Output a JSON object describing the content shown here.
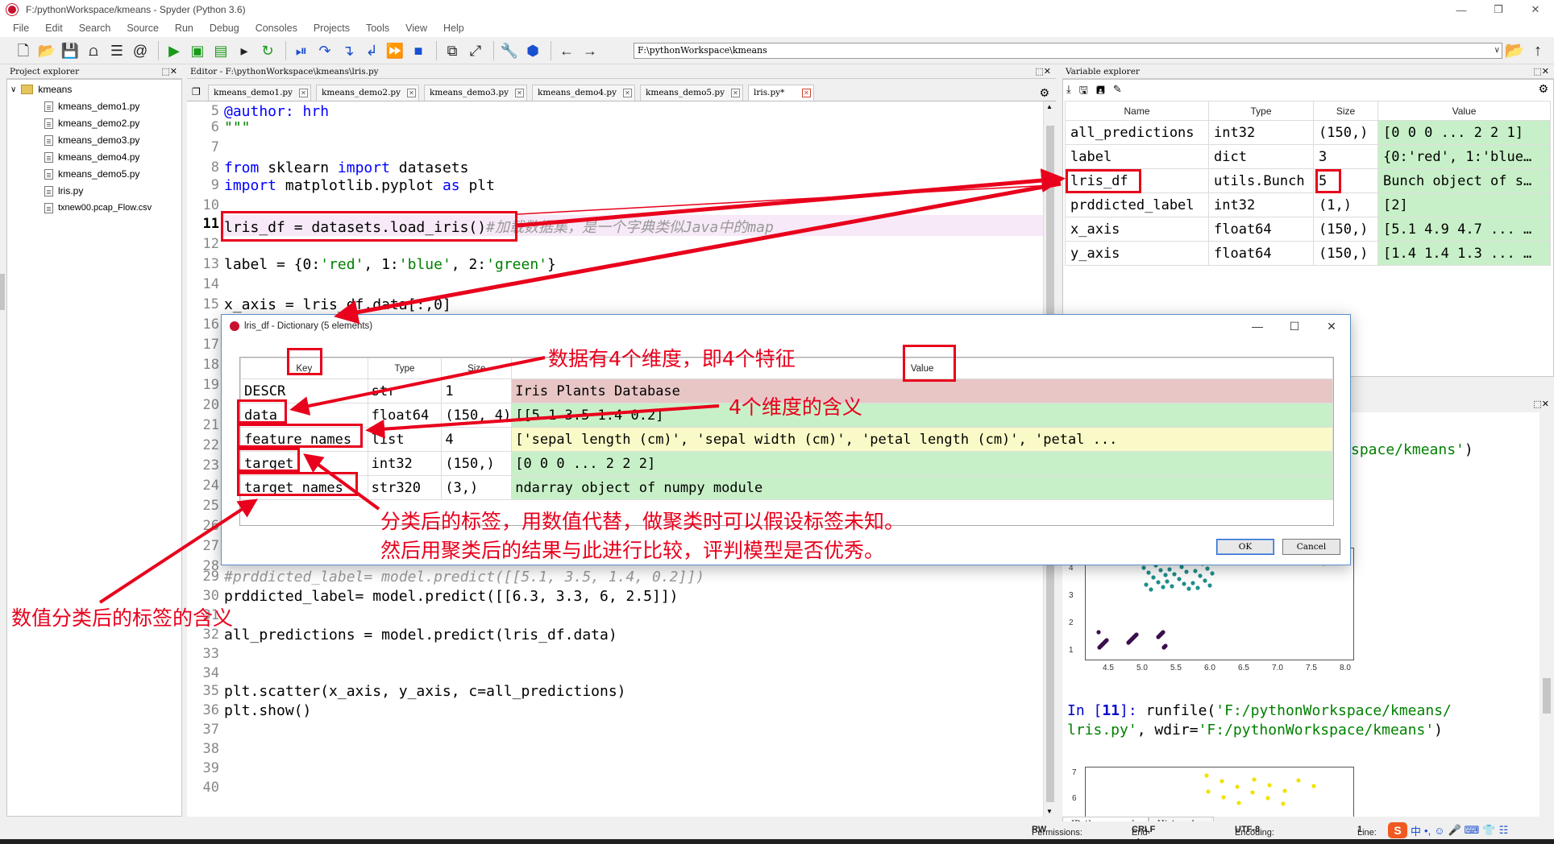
{
  "window": {
    "title": "F:/pythonWorkspace/kmeans - Spyder (Python 3.6)",
    "controls": [
      "—",
      "❒",
      "✕"
    ]
  },
  "menu": [
    "File",
    "Edit",
    "Search",
    "Source",
    "Run",
    "Debug",
    "Consoles",
    "Projects",
    "Tools",
    "View",
    "Help"
  ],
  "toolbar": {
    "path": "F:\\pythonWorkspace\\kmeans"
  },
  "project_explorer": {
    "header": "Project explorer",
    "root": "kmeans",
    "files": [
      "kmeans_demo1.py",
      "kmeans_demo2.py",
      "kmeans_demo3.py",
      "kmeans_demo4.py",
      "kmeans_demo5.py",
      "lris.py",
      "txnew00.pcap_Flow.csv"
    ]
  },
  "editor": {
    "header": "Editor - F:\\pythonWorkspace\\kmeans\\lris.py",
    "tabs": [
      "kmeans_demo1.py",
      "kmeans_demo2.py",
      "kmeans_demo3.py",
      "kmeans_demo4.py",
      "kmeans_demo5.py",
      "lris.py*"
    ],
    "line_numbers": [
      "5",
      "6",
      "7",
      "8",
      "9",
      "10",
      "11",
      "12",
      "13",
      "14",
      "15",
      "16",
      "17",
      "18",
      "19",
      "20",
      "21",
      "22",
      "23",
      "24",
      "25",
      "26",
      "27",
      "28",
      "29",
      "30",
      "31",
      "32",
      "33",
      "34",
      "35",
      "36",
      "37",
      "38",
      "39",
      "40"
    ],
    "lines": {
      "l5": "@author: hrh",
      "l6": "\"\"\"",
      "l8_a": "from",
      "l8_b": " sklearn ",
      "l8_c": "import",
      "l8_d": " datasets",
      "l9_a": "import",
      "l9_b": " matplotlib.pyplot ",
      "l9_c": "as",
      "l9_d": " plt",
      "l11_code": "lris_df = datasets.load_iris()",
      "l11_comment": "#加载数据集，是一个字典类似Java中的map",
      "l13_a": "label = {0:",
      "l13_b": "'red'",
      "l13_c": ", 1:",
      "l13_d": "'blue'",
      "l13_e": ", 2:",
      "l13_f": "'green'",
      "l13_g": "}",
      "l15": "x_axis = lris_df.data[:,0]",
      "l29": "#prddicted_label= model.predict([[5.1, 3.5, 1.4, 0.2]])",
      "l30": "prddicted_label= model.predict([[6.3, 3.3, 6, 2.5]])",
      "l32": "all_predictions = model.predict(lris_df.data)",
      "l35": "plt.scatter(x_axis, y_axis, c=all_predictions)",
      "l36": "plt.show()"
    }
  },
  "variable_explorer": {
    "header": "Variable explorer",
    "columns": [
      "Name",
      "Type",
      "Size",
      "Value"
    ],
    "rows": [
      {
        "name": "all_predictions",
        "type": "int32",
        "size": "(150,)",
        "value": "[0 0 0 ... 2 2 1]"
      },
      {
        "name": "label",
        "type": "dict",
        "size": "3",
        "value": "{0:'red', 1:'blue…"
      },
      {
        "name": "lris_df",
        "type": "utils.Bunch",
        "size": "5",
        "value": "Bunch object of s…"
      },
      {
        "name": "prddicted_label",
        "type": "int32",
        "size": "(1,)",
        "value": "[2]"
      },
      {
        "name": "x_axis",
        "type": "float64",
        "size": "(150,)",
        "value": "[5.1 4.9 4.7 ... …"
      },
      {
        "name": "y_axis",
        "type": "float64",
        "size": "(150,)",
        "value": "[1.4 1.4 1.3 ... …"
      }
    ]
  },
  "console": {
    "partial_top_a": "space/kmeans'",
    "partial_top_b": ")",
    "prompt": "In [",
    "prompt_num": "11",
    "prompt_end": "]: ",
    "cmd_a": "runfile(",
    "cmd_b": "'F:/pythonWorkspace/kmeans/",
    "cmd_c": "lris.py'",
    "cmd_d": ", wdir=",
    "cmd_e": "'F:/pythonWorkspace/kmeans'",
    "cmd_f": ")",
    "plot1_yticks": [
      "4",
      "3",
      "2",
      "1"
    ],
    "plot1_xticks": [
      "4.5",
      "5.0",
      "5.5",
      "6.0",
      "6.5",
      "7.0",
      "7.5",
      "8.0"
    ],
    "plot2_yticks": [
      "7",
      "6"
    ],
    "tabs": [
      "IPython console",
      "History log"
    ]
  },
  "status": {
    "permissions_label": "Permissions:",
    "permissions": "RW",
    "eol_label": "End-of-lines:",
    "eol": "CRLF",
    "encoding_label": "Encoding:",
    "encoding": "UTF-8",
    "line_label": "Line:",
    "line_value": "1",
    "ime_logo": "S",
    "ime_mode": "中"
  },
  "dialog": {
    "title": "lris_df - Dictionary (5 elements)",
    "controls": [
      "—",
      "☐",
      "✕"
    ],
    "columns": [
      "Key",
      "Type",
      "Size",
      "Value"
    ],
    "rows": [
      {
        "key": "DESCR",
        "type": "str",
        "size": "1",
        "value": "Iris Plants Database"
      },
      {
        "key": "data",
        "type": "float64",
        "size": "(150, 4)",
        "value": "[[5.1 3.5 1.4 0.2]"
      },
      {
        "key": "feature_names",
        "type": "list",
        "size": "4",
        "value": "['sepal length (cm)', 'sepal width (cm)', 'petal length (cm)', 'petal ..."
      },
      {
        "key": "target",
        "type": "int32",
        "size": "(150,)",
        "value": "[0 0 0 ... 2 2 2]"
      },
      {
        "key": "target_names",
        "type": "str320",
        "size": "(3,)",
        "value": "ndarray object of numpy module"
      }
    ],
    "ok": "OK",
    "cancel": "Cancel"
  },
  "annotations": {
    "dims": "数据有4个维度，即4个特征",
    "dims_meaning": "4个维度的含义",
    "labels_1": "分类后的标签，用数值代替，做聚类时可以假设标签未知。",
    "labels_2": "然后用聚类后的结果与此进行比较，评判模型是否优秀。",
    "label_names": "数值分类后的标签的含义"
  },
  "colors": {
    "annotation": "#e8001c",
    "green_row": "#c8f0c8",
    "red_row": "#e8c6c6",
    "yellow_row": "#fafac8"
  }
}
